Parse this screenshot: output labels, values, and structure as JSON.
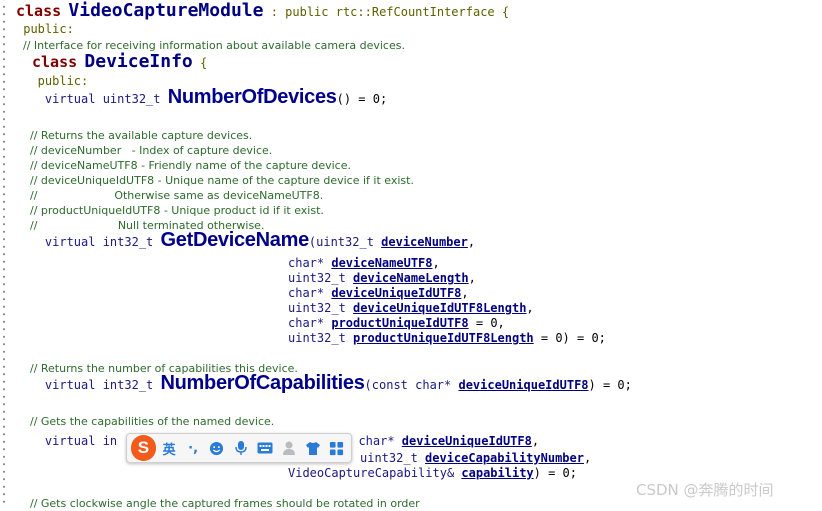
{
  "code": {
    "l1_kw": "class",
    "l1_name": "VideoCaptureModule",
    "l1_rest": " : public rtc::RefCountInterface {",
    "l2": " public:",
    "l3": "  // Interface for receiving information about available camera devices.",
    "l4_kw": "class",
    "l4_name": "DeviceInfo",
    "l4_rest": " {",
    "l5": "   public:",
    "l6_pre": "    virtual uint32_t ",
    "l6_fn": "NumberOfDevices",
    "l6_post": "() = 0;",
    "c1": "    // Returns the available capture devices.",
    "c2": "    // deviceNumber   - Index of capture device.",
    "c3": "    // deviceNameUTF8 - Friendly name of the capture device.",
    "c4": "    // deviceUniqueIdUTF8 - Unique name of the capture device if it exist.",
    "c5": "    //                      Otherwise same as deviceNameUTF8.",
    "c6": "    // productUniqueIdUTF8 - Unique product id if it exist.",
    "c7": "    //                       Null terminated otherwise.",
    "g_pre": "    virtual int32_t ",
    "g_fn": "GetDeviceName",
    "g_a1_t": "(uint32_t ",
    "g_a1_p": "deviceNumber",
    "g_a1_e": ",",
    "g_a2_t": "char* ",
    "g_a2_p": "deviceNameUTF8",
    "g_a2_e": ",",
    "g_a3_t": "uint32_t ",
    "g_a3_p": "deviceNameLength",
    "g_a3_e": ",",
    "g_a4_t": "char* ",
    "g_a4_p": "deviceUniqueIdUTF8",
    "g_a4_e": ",",
    "g_a5_t": "uint32_t ",
    "g_a5_p": "deviceUniqueIdUTF8Length",
    "g_a5_e": ",",
    "g_a6_t": "char* ",
    "g_a6_p": "productUniqueIdUTF8",
    "g_a6_e": " = 0,",
    "g_a7_t": "uint32_t ",
    "g_a7_p": "productUniqueIdUTF8Length",
    "g_a7_e": " = 0) = 0;",
    "c8": "    // Returns the number of capabilities this device.",
    "n_pre": "    virtual int32_t ",
    "n_fn": "NumberOfCapabilities",
    "n_a1_t": "(const char* ",
    "n_a1_p": "deviceUniqueIdUTF8",
    "n_a1_e": ") = 0;",
    "c9": "    // Gets the capabilities of the named device.",
    "gc_pre": "    virtual in",
    "gc_a1_t": "t char* ",
    "gc_a1_p": "deviceUniqueIdUTF8",
    "gc_a1_e": ",",
    "gc_a2_t": "uint32_t ",
    "gc_a2_p": "deviceCapabilityNumber",
    "gc_a2_e": ",",
    "gc_a3_t": "VideoCaptureCapability& ",
    "gc_a3_p": "capability",
    "gc_a3_e": ") = 0;",
    "c10": "    // Gets clockwise angle the captured frames should be rotated in order"
  },
  "ime": {
    "logo": "S",
    "lang": "英",
    "punct": "·,",
    "emoji_icon": "smile-icon",
    "mic_icon": "microphone-icon",
    "keyboard_icon": "keyboard-icon",
    "user_icon": "user-icon",
    "skin_icon": "shirt-icon",
    "apps_icon": "grid-icon"
  },
  "watermark": "CSDN @奔腾的时间"
}
